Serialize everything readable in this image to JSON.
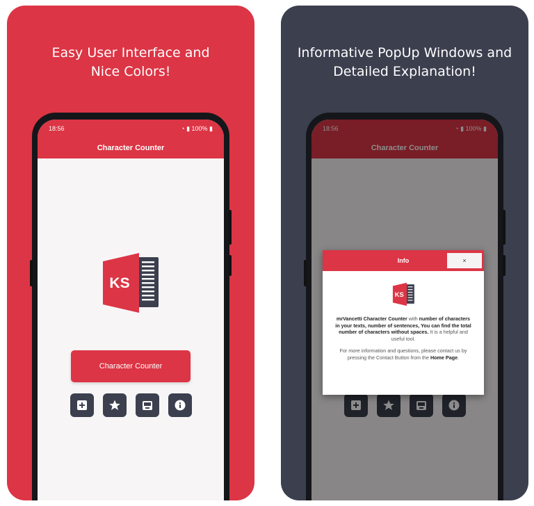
{
  "colors": {
    "accent": "#dc3545",
    "dark": "#3b3f4e",
    "screen_bg": "#f8f5f6"
  },
  "left_panel": {
    "headline": "Easy User Interface and\nNice Colors!",
    "status": {
      "time": "18:56",
      "battery": "100%"
    },
    "app_title": "Character Counter",
    "logo_text": "KS",
    "main_button": "Character Counter",
    "icon_buttons": [
      "add-box-icon",
      "star-icon",
      "contact-icon",
      "info-icon"
    ]
  },
  "right_panel": {
    "headline": "Informative PopUp Windows and\nDetailed Explanation!",
    "status": {
      "time": "18:56",
      "battery": "100%"
    },
    "app_title": "Character Counter",
    "dialog": {
      "title": "Info",
      "close": "×",
      "logo_text": "KS",
      "p1_a": "mrVancetti Character Counter",
      "p1_b": " with ",
      "p1_c": "number of characters in your texts, number of sentences, You can find the total number of characters without spaces.",
      "p1_d": " It is a helpful and useful tool.",
      "p2_a": "For more information and questions, please contact us by pressing the Contact Button from the ",
      "p2_b": "Home Page",
      "p2_c": "."
    }
  }
}
